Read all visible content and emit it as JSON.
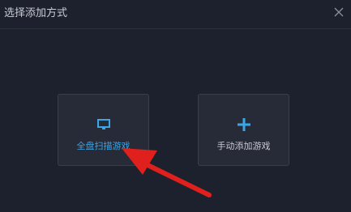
{
  "dialog": {
    "title": "选择添加方式",
    "close_icon": "close-icon"
  },
  "options": [
    {
      "label": "全盘扫描游戏",
      "icon": "monitor-icon"
    },
    {
      "label": "手动添加游戏",
      "icon": "plus-icon"
    }
  ],
  "annotation": {
    "icon": "red-arrow-icon",
    "color": "#e0201c"
  },
  "colors": {
    "background": "#1d202d",
    "card": "#272a37",
    "accent": "#3aa6e6",
    "text": "#c9ccd4"
  }
}
